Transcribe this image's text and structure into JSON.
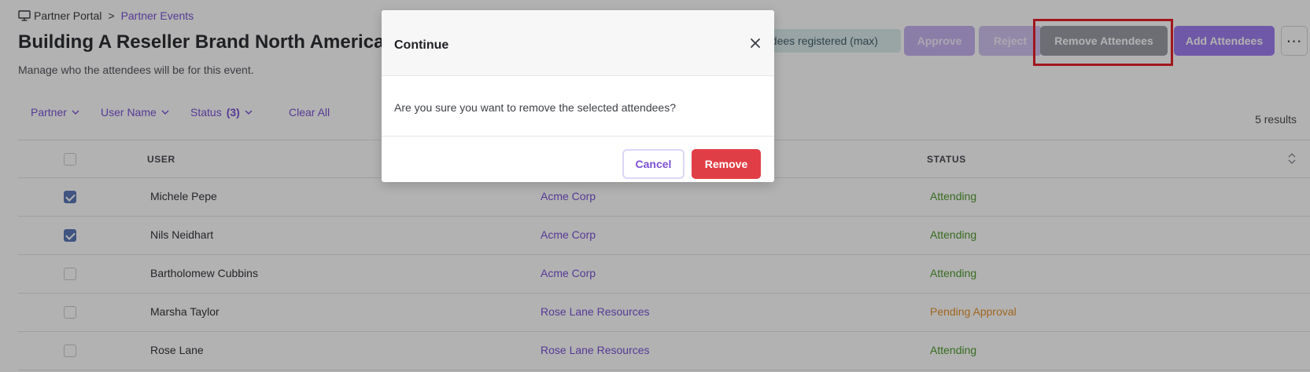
{
  "breadcrumb": {
    "root": "Partner Portal",
    "separator": ">",
    "current": "Partner Events"
  },
  "page": {
    "title": "Building A Reseller Brand North America",
    "subtitle": "Manage who the attendees will be for this event."
  },
  "header_actions": {
    "capacity_badge": "ndees registered (max)",
    "approve": "Approve",
    "reject": "Reject",
    "remove_attendees": "Remove Attendees",
    "add_attendees": "Add Attendees",
    "more": "⋯"
  },
  "filters": {
    "partner": "Partner",
    "user_name": "User Name",
    "status": "Status",
    "status_count": "(3)",
    "clear_all": "Clear All"
  },
  "results_count": "5 results",
  "table": {
    "columns": {
      "user": "USER",
      "status": "STATUS"
    },
    "rows": [
      {
        "user": "Michele Pepe",
        "partner": "Acme Corp",
        "status": "Attending",
        "checked": true
      },
      {
        "user": "Nils Neidhart",
        "partner": "Acme Corp",
        "status": "Attending",
        "checked": true
      },
      {
        "user": "Bartholomew Cubbins",
        "partner": "Acme Corp",
        "status": "Attending",
        "checked": false
      },
      {
        "user": "Marsha Taylor",
        "partner": "Rose Lane Resources",
        "status": "Pending Approval",
        "checked": false
      },
      {
        "user": "Rose Lane",
        "partner": "Rose Lane Resources",
        "status": "Attending",
        "checked": false
      }
    ]
  },
  "modal": {
    "title": "Continue",
    "message": "Are you sure you want to remove the selected attendees?",
    "cancel": "Cancel",
    "remove": "Remove"
  },
  "colors": {
    "accent": "#7b52d6",
    "danger": "#e03e46",
    "attending": "#4f9b2f",
    "pending": "#e6922e"
  }
}
